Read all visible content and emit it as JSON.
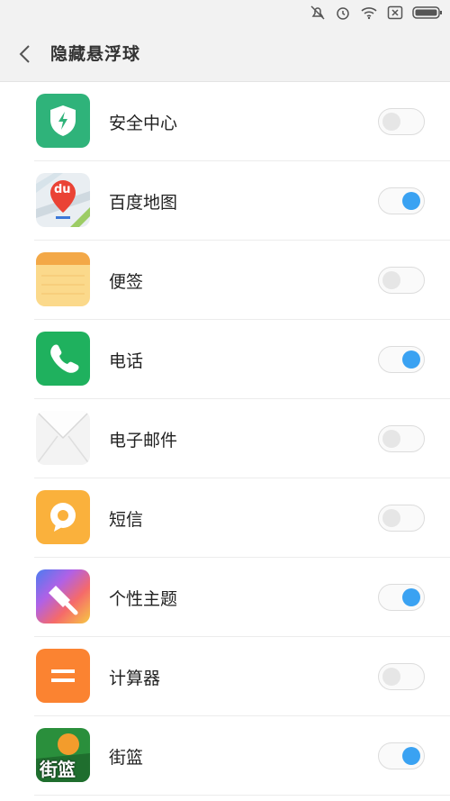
{
  "header": {
    "title": "隐藏悬浮球"
  },
  "apps": [
    {
      "name": "安全中心",
      "icon": "security-center-icon",
      "enabled": false
    },
    {
      "name": "百度地图",
      "icon": "baidu-map-icon",
      "enabled": true,
      "icon_text": "du"
    },
    {
      "name": "便签",
      "icon": "notes-icon",
      "enabled": false
    },
    {
      "name": "电话",
      "icon": "phone-icon",
      "enabled": true
    },
    {
      "name": "电子邮件",
      "icon": "email-icon",
      "enabled": false
    },
    {
      "name": "短信",
      "icon": "sms-icon",
      "enabled": false
    },
    {
      "name": "个性主题",
      "icon": "themes-icon",
      "enabled": true
    },
    {
      "name": "计算器",
      "icon": "calculator-icon",
      "enabled": false
    },
    {
      "name": "街篮",
      "icon": "street-basketball-icon",
      "enabled": true,
      "icon_text": "街篮"
    }
  ],
  "colors": {
    "toggle_on": "#3aa2f2",
    "header_bg": "#f2f2f2"
  }
}
